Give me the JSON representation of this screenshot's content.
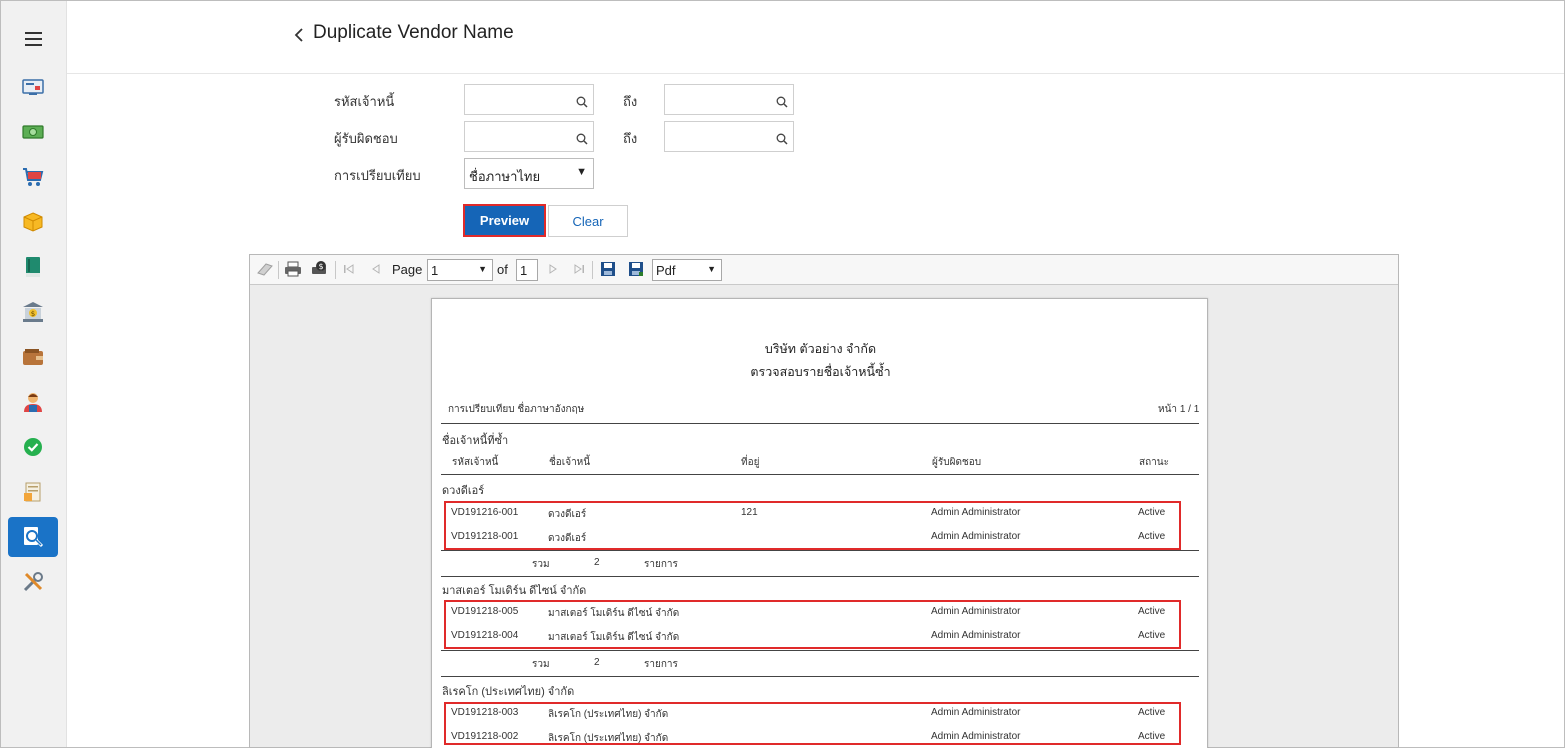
{
  "header": {
    "title": "Duplicate Vendor Name"
  },
  "sidebar": {
    "icons": [
      "dashboard-icon",
      "money-icon",
      "cart-icon",
      "box-icon",
      "book-icon",
      "bank-icon",
      "wallet-icon",
      "people-icon",
      "approve-check-icon",
      "document-icon",
      "report-search-icon",
      "tools-icon"
    ],
    "active_index": 10
  },
  "form": {
    "vendor_code_label": "รหัสเจ้าหนี้",
    "vendor_code_from": "",
    "vendor_code_to_label": "ถึง",
    "vendor_code_to": "",
    "responsible_label": "ผู้รับผิดชอบ",
    "responsible_from": "",
    "responsible_to_label": "ถึง",
    "responsible_to": "",
    "compare_label": "การเปรียบเทียบ",
    "compare_value": "ชื่อภาษาไทย",
    "preview_label": "Preview",
    "clear_label": "Clear"
  },
  "viewer": {
    "page_label": "Page",
    "page_value": "1",
    "of_label": "of",
    "total_pages": "1",
    "export_format": "Pdf"
  },
  "report": {
    "company": "บริษัท ตัวอย่าง จำกัด",
    "title": "ตรวจสอบรายชื่อเจ้าหนี้ซ้ำ",
    "compare_text": "การเปรียบเทียบ ชื่อภาษาอังกฤษ",
    "page_text": "หน้า 1 / 1",
    "section_title": "ชื่อเจ้าหนี้ที่ซ้ำ",
    "columns": [
      "รหัสเจ้าหนี้",
      "ชื่อเจ้าหนี้",
      "ที่อยู่",
      "ผู้รับผิดชอบ",
      "สถานะ"
    ],
    "sum_label": "รวม",
    "items_label": "รายการ",
    "groups": [
      {
        "name": "ดวงดีเอร์",
        "count": "2",
        "rows": [
          {
            "code": "VD191216-001",
            "name": "ดวงดีเอร์",
            "address": "121",
            "owner": "Admin Administrator",
            "status": "Active"
          },
          {
            "code": "VD191218-001",
            "name": "ดวงดีเอร์",
            "address": "",
            "owner": "Admin Administrator",
            "status": "Active"
          }
        ]
      },
      {
        "name": "มาสเตอร์ โมเดิร์น ดีไซน์ จำกัด",
        "count": "2",
        "rows": [
          {
            "code": "VD191218-005",
            "name": "มาสเตอร์ โมเดิร์น ดีไซน์ จำกัด",
            "address": "",
            "owner": "Admin Administrator",
            "status": "Active"
          },
          {
            "code": "VD191218-004",
            "name": "มาสเตอร์ โมเดิร์น ดีไซน์ จำกัด",
            "address": "",
            "owner": "Admin Administrator",
            "status": "Active"
          }
        ]
      },
      {
        "name": "ลิเรคโก (ประเทศไทย) จำกัด",
        "count": "",
        "rows": [
          {
            "code": "VD191218-003",
            "name": "ลิเรคโก (ประเทศไทย) จำกัด",
            "address": "",
            "owner": "Admin Administrator",
            "status": "Active"
          },
          {
            "code": "VD191218-002",
            "name": "ลิเรคโก (ประเทศไทย) จำกัด",
            "address": "",
            "owner": "Admin Administrator",
            "status": "Active"
          }
        ]
      }
    ]
  },
  "colors": {
    "accent": "#1565b7",
    "highlight": "#e02a2a",
    "active_nav": "#1a73c7"
  }
}
